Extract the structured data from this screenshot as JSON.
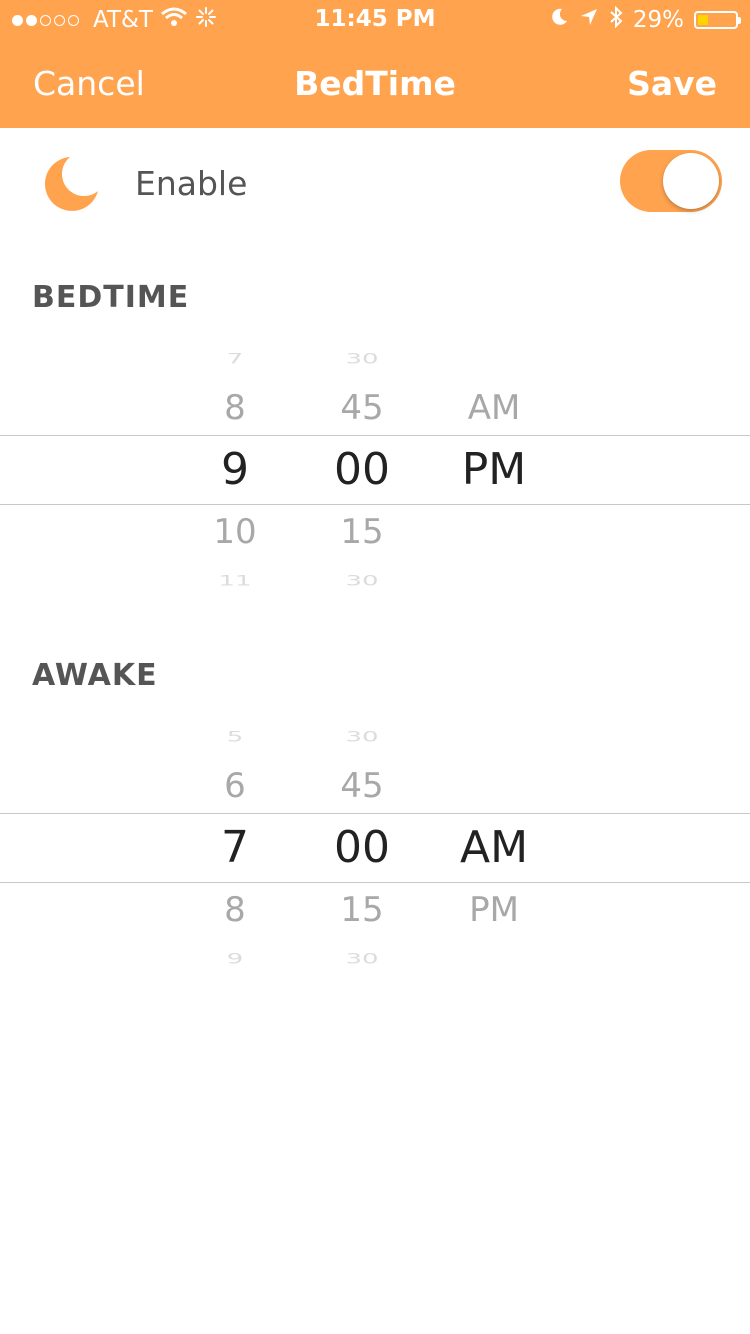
{
  "status_bar": {
    "carrier": "AT&T",
    "time": "11:45 PM",
    "battery": "29%",
    "battery_level": 0.29,
    "signal_bars_filled": 2,
    "signal_bars_total": 5
  },
  "nav": {
    "cancel": "Cancel",
    "title": "BedTime",
    "save": "Save"
  },
  "enable": {
    "label": "Enable",
    "on": true
  },
  "bedtime": {
    "title": "BEDTIME",
    "hours": [
      "7",
      "8",
      "9",
      "10",
      "11"
    ],
    "minutes": [
      "30",
      "45",
      "00",
      "15",
      "30"
    ],
    "periods": [
      "",
      "AM",
      "PM",
      "",
      ""
    ],
    "selected": {
      "hour": "9",
      "minute": "00",
      "period": "PM"
    }
  },
  "awake": {
    "title": "AWAKE",
    "hours": [
      "5",
      "6",
      "7",
      "8",
      "9"
    ],
    "minutes": [
      "30",
      "45",
      "00",
      "15",
      "30"
    ],
    "periods": [
      "",
      "",
      "AM",
      "PM",
      ""
    ],
    "selected": {
      "hour": "7",
      "minute": "00",
      "period": "AM"
    }
  },
  "colors": {
    "accent": "#FFA34F",
    "battery_fill": "#FFD400"
  },
  "icons": [
    "wifi-icon",
    "activity-icon",
    "moon-icon",
    "location-icon",
    "bluetooth-icon",
    "battery-icon"
  ]
}
